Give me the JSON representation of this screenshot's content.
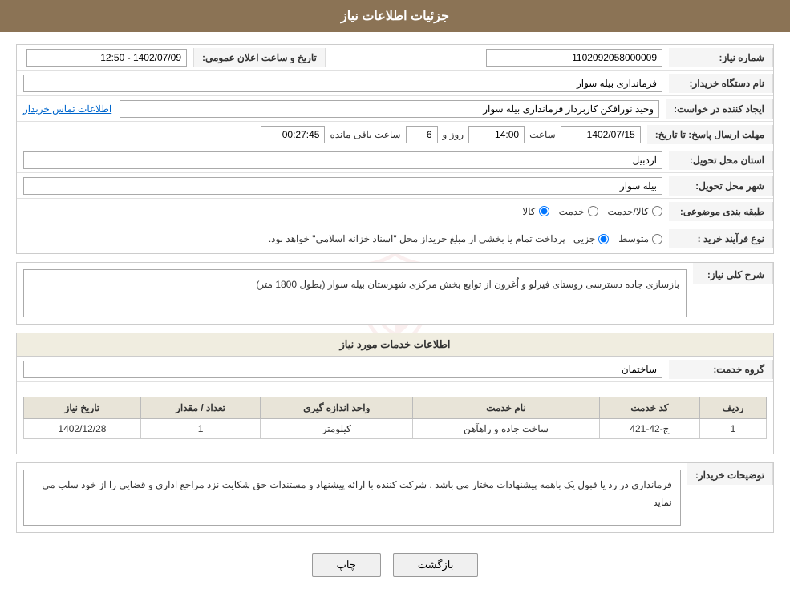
{
  "header": {
    "title": "جزئیات اطلاعات نیاز"
  },
  "fields": {
    "shomareNiaz_label": "شماره نیاز:",
    "shomareNiaz_value": "1102092058000009",
    "namedastgah_label": "نام دستگاه خریدار:",
    "namedastgah_value": "فرمانداری بیله سوار",
    "eijadKonande_label": "ایجاد کننده در خواست:",
    "eijadKonande_value": "وحید نورافکن کاربرداز فرمانداری بیله سوار",
    "eijadKonande_link": "اطلاعات تماس خریدار",
    "mohlat_label": "مهلت ارسال پاسخ: تا تاریخ:",
    "mohlat_date": "1402/07/15",
    "mohlat_saat_label": "ساعت",
    "mohlat_saat_value": "14:00",
    "mohlat_roz_label": "روز و",
    "mohlat_roz_value": "6",
    "mohlat_baghimande_label": "ساعت باقی مانده",
    "mohlat_baghimande_value": "00:27:45",
    "ostan_label": "استان محل تحویل:",
    "ostan_value": "اردبیل",
    "shahr_label": "شهر محل تحویل:",
    "shahr_value": "بیله سوار",
    "tarifeBandi_label": "طبقه بندی موضوعی:",
    "tarifeBandi_kala": "کالا",
    "tarifeBandi_khadamat": "خدمت",
    "tarifeBandi_kala_khadamat": "کالا/خدمت",
    "noeFarayand_label": "نوع فرآیند خرید :",
    "noeFarayand_jozii": "جزیی",
    "noeFarayand_motavasset": "متوسط",
    "noeFarayand_text": "پرداخت تمام یا بخشی از مبلغ خریداز محل \"اسناد خزانه اسلامی\" خواهد بود.",
    "tarikhElan_label": "تاریخ و ساعت اعلان عمومی:",
    "tarikhElan_value": "1402/07/09 - 12:50",
    "sharhKolli_label": "شرح کلی نیاز:",
    "sharhKolli_value": "بازسازی جاده دسترسی روستای فیرلو و اُغرون از توابع بخش مرکزی شهرستان بیله سوار (بطول 1800 متر)",
    "infoKhadamat_title": "اطلاعات خدمات مورد نیاز",
    "groheKhadamat_label": "گروه خدمت:",
    "groheKhadamat_value": "ساختمان",
    "table": {
      "headers": [
        "ردیف",
        "کد خدمت",
        "نام خدمت",
        "واحد اندازه گیری",
        "تعداد / مقدار",
        "تاریخ نیاز"
      ],
      "rows": [
        {
          "radif": "1",
          "code": "ج-42-421",
          "name": "ساخت جاده و راهآهن",
          "unit": "کیلومتر",
          "count": "1",
          "date": "1402/12/28"
        }
      ]
    },
    "tozihat_label": "توضیحات خریدار:",
    "tozihat_value": "فرمانداری در رد یا قبول یک باهمه پیشنهادات مختار می باشد . شرکت کننده با ارائه پیشنهاد و مستندات حق شکایت نزد مراجع اداری و قضایی را از خود سلب می نماید"
  },
  "buttons": {
    "print_label": "چاپ",
    "back_label": "بازگشت"
  }
}
